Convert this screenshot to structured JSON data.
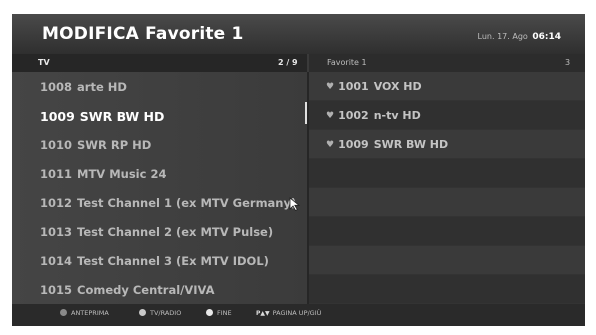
{
  "header": {
    "title": "MODIFICA Favorite 1",
    "date": "Lun. 17. Ago",
    "time": "06:14"
  },
  "left_panel": {
    "label": "TV",
    "page": "2 / 9",
    "items": [
      {
        "num": "1008",
        "name": "arte HD"
      },
      {
        "num": "1009",
        "name": "SWR BW HD"
      },
      {
        "num": "1010",
        "name": "SWR RP HD"
      },
      {
        "num": "1011",
        "name": "MTV Music 24"
      },
      {
        "num": "1012",
        "name": "Test Channel 1 (ex MTV Germany)"
      },
      {
        "num": "1013",
        "name": "Test Channel 2 (ex MTV Pulse)"
      },
      {
        "num": "1014",
        "name": "Test Channel 3 (Ex MTV IDOL)"
      },
      {
        "num": "1015",
        "name": "Comedy Central/VIVA"
      }
    ],
    "selected_index": 1
  },
  "right_panel": {
    "label": "Favorite 1",
    "count": "3",
    "items": [
      {
        "num": "1001",
        "name": "VOX HD"
      },
      {
        "num": "1002",
        "name": "n-tv HD"
      },
      {
        "num": "1009",
        "name": "SWR BW HD"
      }
    ]
  },
  "footer": {
    "legend": [
      {
        "label": "ANTEPRIMA",
        "color": "#8a8a8a"
      },
      {
        "label": "TV/RADIO",
        "color": "#c8c8c8"
      },
      {
        "label": "FINE",
        "color": "#e8e8e8"
      }
    ],
    "page_keys": "P▲▼",
    "page_label": "PAGINA UP/GIÙ"
  },
  "icons": {
    "favorite": "heart-icon",
    "pointer": "mouse-cursor-icon"
  }
}
